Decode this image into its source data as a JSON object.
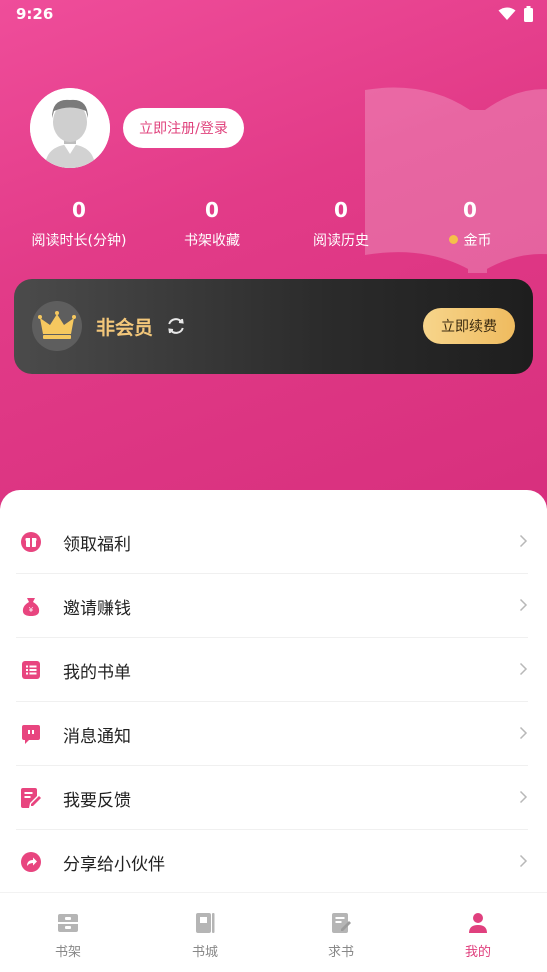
{
  "status": {
    "time": "9:26"
  },
  "profile": {
    "login_label": "立即注册/登录"
  },
  "stats": [
    {
      "value": "0",
      "label": "阅读时长(分钟)"
    },
    {
      "value": "0",
      "label": "书架收藏"
    },
    {
      "value": "0",
      "label": "阅读历史"
    },
    {
      "value": "0",
      "label": "金币"
    }
  ],
  "vip": {
    "status": "非会员",
    "renew_label": "立即续费"
  },
  "menu": [
    {
      "label": "领取福利",
      "icon": "gift-icon"
    },
    {
      "label": "邀请赚钱",
      "icon": "money-bag-icon"
    },
    {
      "label": "我的书单",
      "icon": "list-icon"
    },
    {
      "label": "消息通知",
      "icon": "message-icon"
    },
    {
      "label": "我要反馈",
      "icon": "feedback-icon"
    },
    {
      "label": "分享给小伙伴",
      "icon": "share-icon"
    }
  ],
  "tabs": [
    {
      "label": "书架",
      "icon": "bookshelf-icon",
      "active": false
    },
    {
      "label": "书城",
      "icon": "bookstore-icon",
      "active": false
    },
    {
      "label": "求书",
      "icon": "request-book-icon",
      "active": false
    },
    {
      "label": "我的",
      "icon": "user-icon",
      "active": true
    }
  ],
  "colors": {
    "accent": "#e0407e",
    "gold": "#f3c77a",
    "inactive": "#888888"
  }
}
